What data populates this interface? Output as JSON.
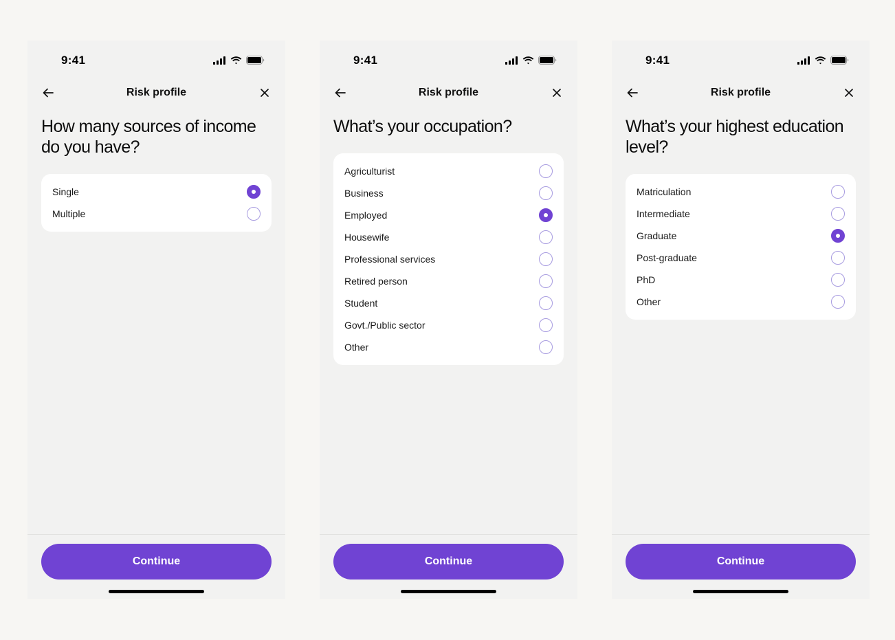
{
  "colors": {
    "accent": "#7043d3",
    "radio_border": "#a79be0",
    "card": "#ffffff",
    "screen_bg": "#f2f2f1",
    "page_bg": "#f7f6f3"
  },
  "screens": [
    {
      "status_time": "9:41",
      "nav_title": "Risk profile",
      "question": "How many sources of income do you have?",
      "options": [
        {
          "label": "Single",
          "selected": true
        },
        {
          "label": "Multiple",
          "selected": false
        }
      ],
      "continue_label": "Continue"
    },
    {
      "status_time": "9:41",
      "nav_title": "Risk profile",
      "question": "What’s your occupation?",
      "options": [
        {
          "label": "Agriculturist",
          "selected": false
        },
        {
          "label": "Business",
          "selected": false
        },
        {
          "label": "Employed",
          "selected": true
        },
        {
          "label": "Housewife",
          "selected": false
        },
        {
          "label": "Professional services",
          "selected": false
        },
        {
          "label": "Retired person",
          "selected": false
        },
        {
          "label": "Student",
          "selected": false
        },
        {
          "label": "Govt./Public sector",
          "selected": false
        },
        {
          "label": "Other",
          "selected": false
        }
      ],
      "continue_label": "Continue"
    },
    {
      "status_time": "9:41",
      "nav_title": "Risk profile",
      "question": "What’s your highest education level?",
      "options": [
        {
          "label": "Matriculation",
          "selected": false
        },
        {
          "label": "Intermediate",
          "selected": false
        },
        {
          "label": "Graduate",
          "selected": true
        },
        {
          "label": "Post-graduate",
          "selected": false
        },
        {
          "label": "PhD",
          "selected": false
        },
        {
          "label": "Other",
          "selected": false
        }
      ],
      "continue_label": "Continue"
    }
  ]
}
